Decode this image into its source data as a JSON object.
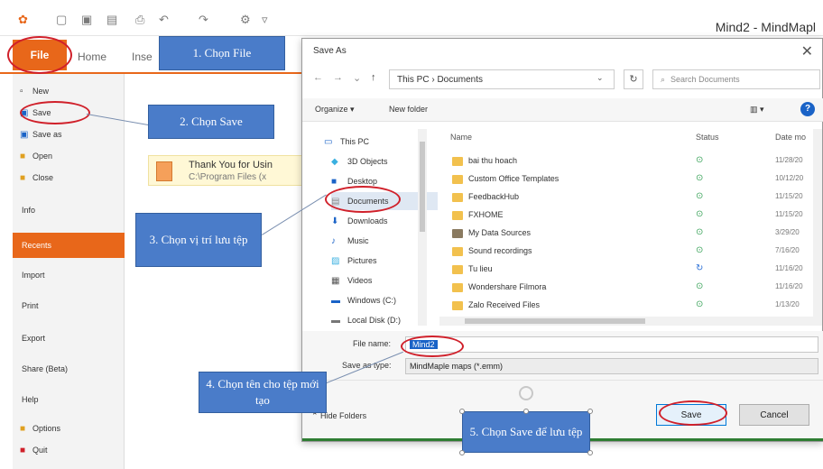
{
  "app": {
    "title": "Mind2 - MindMapl"
  },
  "ribbon": {
    "file": "File",
    "home": "Home",
    "insert": "Inse"
  },
  "sidebar": {
    "items": [
      {
        "label": "New",
        "icon": "new-doc-icon"
      },
      {
        "label": "Save",
        "icon": "save-icon"
      },
      {
        "label": "Save as",
        "icon": "save-as-icon"
      },
      {
        "label": "Open",
        "icon": "open-folder-icon"
      },
      {
        "label": "Close",
        "icon": "close-folder-icon"
      },
      {
        "label": "Info"
      },
      {
        "label": "Recents"
      },
      {
        "label": "Import"
      },
      {
        "label": "Print"
      },
      {
        "label": "Export"
      },
      {
        "label": "Share (Beta)"
      },
      {
        "label": "Help"
      },
      {
        "label": "Options",
        "icon": "options-icon"
      },
      {
        "label": "Quit",
        "icon": "quit-icon"
      }
    ]
  },
  "recent": {
    "title": "Thank You for Usin",
    "path": "C:\\Program Files (x"
  },
  "dialog": {
    "title": "Save As",
    "address": "This PC  ›  Documents",
    "search_placeholder": "Search Documents",
    "toolbar": {
      "organize": "Organize ▾",
      "new_folder": "New folder"
    },
    "tree": [
      {
        "label": "This PC",
        "icon": "computer-icon"
      },
      {
        "label": "3D Objects",
        "icon": "cube-icon"
      },
      {
        "label": "Desktop",
        "icon": "desktop-icon"
      },
      {
        "label": "Documents",
        "icon": "documents-icon"
      },
      {
        "label": "Downloads",
        "icon": "download-icon"
      },
      {
        "label": "Music",
        "icon": "music-icon"
      },
      {
        "label": "Pictures",
        "icon": "pictures-icon"
      },
      {
        "label": "Videos",
        "icon": "videos-icon"
      },
      {
        "label": "Windows (C:)",
        "icon": "drive-icon"
      },
      {
        "label": "Local Disk (D:)",
        "icon": "drive-icon"
      }
    ],
    "columns": {
      "name": "Name",
      "status": "Status",
      "date": "Date mo"
    },
    "files": [
      {
        "name": "bai thu hoach",
        "status": "synced",
        "date": "11/28/20"
      },
      {
        "name": "Custom Office Templates",
        "status": "synced",
        "date": "10/12/20"
      },
      {
        "name": "FeedbackHub",
        "status": "synced",
        "date": "11/15/20"
      },
      {
        "name": "FXHOME",
        "status": "synced",
        "date": "11/15/20"
      },
      {
        "name": "My Data Sources",
        "status": "synced",
        "date": "3/29/20"
      },
      {
        "name": "Sound recordings",
        "status": "synced",
        "date": "7/16/20"
      },
      {
        "name": "Tu lieu",
        "status": "syncing",
        "date": "11/16/20"
      },
      {
        "name": "Wondershare Filmora",
        "status": "synced",
        "date": "11/16/20"
      },
      {
        "name": "Zalo Received Files",
        "status": "synced",
        "date": "1/13/20"
      }
    ],
    "file_name_label": "File name:",
    "file_name_value": "Mind2",
    "save_type_label": "Save as type:",
    "save_type_value": "MindMaple maps (*.emm)",
    "hide_folders": "Hide Folders",
    "save_button": "Save",
    "cancel_button": "Cancel"
  },
  "callouts": {
    "step1": "1. Chọn File",
    "step2": "2. Chọn Save",
    "step3": "3. Chọn vị trí lưu tệp",
    "step4": "4. Chọn tên cho tệp mới tạo",
    "step5": "5. Chọn Save để lưu tệp"
  },
  "colors": {
    "accent": "#e8671a",
    "callout": "#4a7cc9",
    "ring": "#d0202a"
  }
}
